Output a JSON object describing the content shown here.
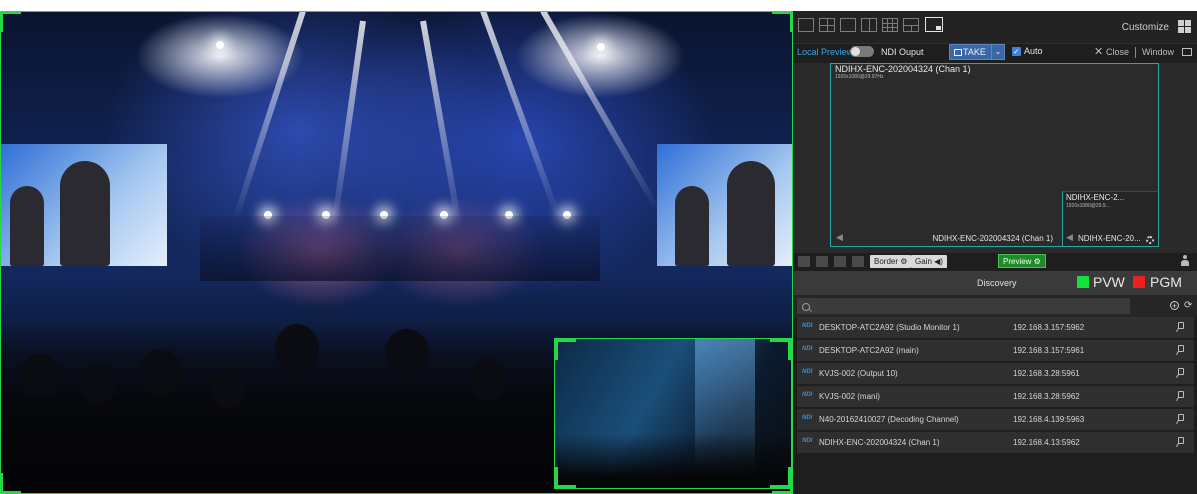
{
  "layout_toolbar": {
    "customize_label": "Customize",
    "layout_icons": [
      "layout-single-icon",
      "layout-quad-icon",
      "layout-wide-icon",
      "layout-split-icon",
      "layout-grid-icon",
      "layout-pip-grid-icon",
      "layout-pip-icon"
    ]
  },
  "preview_controls": {
    "local_preview_label": "Local Preview",
    "ndi_output_label": "NDI Ouput",
    "take_label": "TAKE",
    "auto_label": "Auto",
    "auto_checked": true,
    "close_label": "Close",
    "window_label": "Window"
  },
  "preview_tiles": [
    {
      "name": "NDIHX-ENC-202004324 (Chan 1)",
      "resolution": "1920x1080@29.97Hz",
      "footer": "NDIHX-ENC-202004324 (Chan 1)"
    },
    {
      "name": "NDIHX-ENC-2...",
      "resolution": "1920x1080@29.9...",
      "footer": "NDIHX-ENC-20..."
    }
  ],
  "tile_toolbar": {
    "border_label": "Border",
    "gain_label": "Gain",
    "preview_label": "Preview"
  },
  "status": {
    "discovery_label": "Discovery",
    "pvw_label": "PVW",
    "pgm_label": "PGM",
    "pvw_color": "#13e03a",
    "pgm_color": "#ef1f1f"
  },
  "search": {
    "value": "",
    "placeholder": ""
  },
  "sources": [
    {
      "name": "DESKTOP-ATC2A92 (Studio Monitor 1)",
      "ip": "192.168.3.157:5962"
    },
    {
      "name": "DESKTOP-ATC2A92 (main)",
      "ip": "192.168.3.157:5961"
    },
    {
      "name": "KVJS-002 (Output 10)",
      "ip": "192.168.3.28:5961"
    },
    {
      "name": "KVJS-002 (mani)",
      "ip": "192.168.3.28:5962"
    },
    {
      "name": "N40-20162410027 (Decoding Channel)",
      "ip": "192.168.4.139:5963"
    },
    {
      "name": "NDIHX-ENC-202004324 (Chan 1)",
      "ip": "192.168.4.13:5962"
    }
  ],
  "source_badge": "NDI",
  "accent_colors": {
    "selection_frame": "#24d84a",
    "tile_border": "#2aa7a4",
    "take_button": "#3b67a4",
    "local_preview": "#36a6e8"
  }
}
